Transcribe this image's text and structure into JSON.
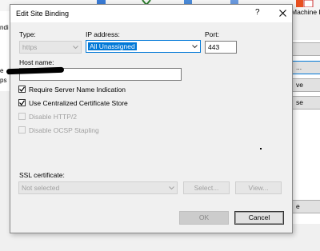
{
  "background": {
    "machine_label": "Machine K",
    "top_item_label": "ab",
    "side_buttons": [
      "",
      "...",
      "ve",
      "se",
      "e"
    ]
  },
  "dialog": {
    "title": "Edit Site Binding",
    "help_glyph": "?",
    "type_label": "Type:",
    "type_value": "https",
    "ip_label": "IP address:",
    "ip_value": "All Unassigned",
    "port_label": "Port:",
    "port_value": "443",
    "host_label": "Host name:",
    "host_value": "",
    "checkboxes": {
      "sni": {
        "label": "Require Server Name Indication",
        "checked": true
      },
      "ccs": {
        "label": "Use Centralized Certificate Store",
        "checked": true
      },
      "http2": {
        "label": "Disable HTTP/2",
        "checked": false
      },
      "ocsp": {
        "label": "Disable OCSP Stapling",
        "checked": false
      }
    },
    "ssl_label": "SSL certificate:",
    "ssl_value": "Not selected",
    "select_button": "Select...",
    "view_button": "View...",
    "ok_button": "OK",
    "cancel_button": "Cancel"
  },
  "colors": {
    "accent": "#0078d7",
    "dialog_bg": "#f0f0f0",
    "disabled_text": "#a0a0a0"
  }
}
